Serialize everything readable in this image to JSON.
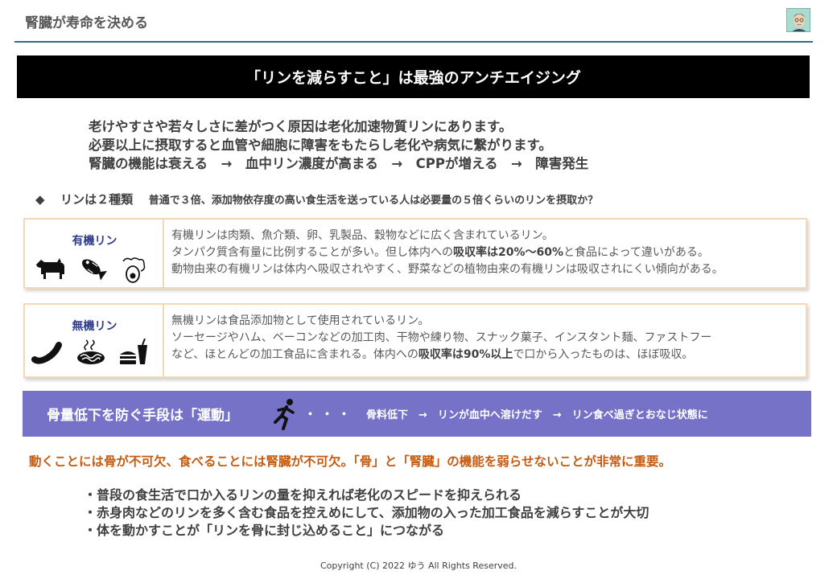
{
  "header": {
    "title": "腎臓が寿命を決める"
  },
  "banner": {
    "text": "「リンを減らすこと」は最強のアンチエイジング"
  },
  "intro": {
    "lines": [
      "老けやすさや若々しさに差がつく原因は老化加速物質リンにあります。",
      "必要以上に摂取すると血管や細胞に障害をもたらし老化や病気に繋がります。",
      "腎臓の機能は衰える　→　血中リン濃度が高まる　→　CPPが増える　→　障害発生"
    ]
  },
  "types": {
    "bullet": "◆",
    "lead": "リンは２種類",
    "note": "普通で３倍、添加物依存度の高い食生活を送っている人は必要量の５倍くらいのリンを摂取か？"
  },
  "organic": {
    "label": "有機リン",
    "icons": [
      "cow-icon",
      "fish-icon",
      "egg-icon"
    ],
    "line1": "有機リンは肉類、魚介類、卵、乳製品、穀物などに広く含まれているリン。",
    "line2_pre": "タンパク質含有量に比例することが多い。但し体内への",
    "line2_bold": "吸収率は20%～60%",
    "line2_post": "と食品によって違いがある。",
    "line3": "動物由来の有機リンは体内へ吸収されやすく、野菜などの植物由来の有機リンは吸収されにくい傾向がある。"
  },
  "inorganic": {
    "label": "無機リン",
    "icons": [
      "sausage-icon",
      "noodles-icon",
      "fastfood-icon"
    ],
    "line1": "無機リンは食品添加物として使用されているリン。",
    "line2": "ソーセージやハム、ベーコンなどの加工肉、干物や練り物、スナック菓子、インスタント麺、ファストフー",
    "line3_pre": "など、ほとんどの加工食品に含まれる。体内への",
    "line3_bold": "吸収率は90%以上",
    "line3_post": "で口から入ったものは、ほぼ吸収。"
  },
  "exercise": {
    "main": "骨量低下を防ぐ手段は「運動」",
    "runner_icon": "running-person-icon",
    "dots": "・・・",
    "flow": "骨料低下　→　リンが血中へ溶けだす　→　リン食べ過ぎとおなじ状態に"
  },
  "key_message": "動くことには骨が不可欠、食べることには腎臓が不可欠。「骨」と「腎臓」の機能を弱らせないことが非常に重要。",
  "bullets": [
    "・普段の食生活で口か入るリンの量を抑えれば老化のスピードを抑えられる",
    "・赤身肉などのリンを多く含む食品を控えめにして、添加物の入った加工食品を減らすことが大切",
    "・体を動かすことが「リンを骨に封じ込めること」につながる"
  ],
  "footer": "Copyright (C) 2022 ゆう All Rights Reserved.",
  "colors": {
    "accent_rule": "#2e6e7e",
    "card_border": "#f5d9b4",
    "label_blue": "#2e3a8c",
    "purple_bar": "#7672c8",
    "orange_text": "#c55a11"
  }
}
